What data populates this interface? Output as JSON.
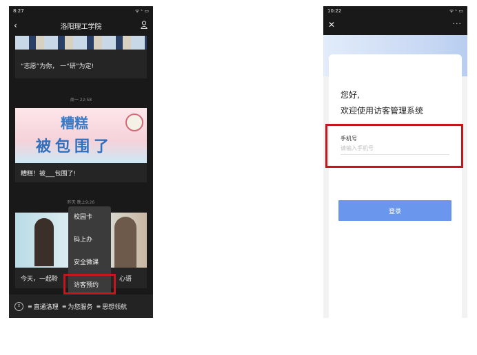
{
  "left_phone": {
    "status": {
      "time": "8:27",
      "right_icons": "ᯤ ᶫ ▭"
    },
    "header": {
      "title": "洛阳理工学院",
      "back_icon": "‹"
    },
    "feed": [
      {
        "caption": "“志愿”为你， 一“研”为定!",
        "timestamp": ""
      },
      {
        "caption": "糟糕！被___包围了!",
        "timestamp": "周一 22:58",
        "banner_title": "糟糕",
        "banner_sub": "被包围了"
      },
      {
        "caption": "今天，一起聆",
        "caption_tail": "心语",
        "timestamp": "昨天 晚上9:26"
      }
    ],
    "popup_menu": [
      "校园卡",
      "码上办",
      "安全微课",
      "访客预约"
    ],
    "tabbar": [
      "直通洛理",
      "为您服务",
      "思想领航"
    ]
  },
  "right_phone": {
    "status": {
      "time": "10:22",
      "right_icons": "ᯤ ᶫ ▭"
    },
    "header": {
      "close_icon": "✕",
      "more_icon": "···"
    },
    "greeting_line1": "您好,",
    "greeting_line2": "欢迎使用访客管理系统",
    "phone_label": "手机号",
    "phone_placeholder": "请输入手机号",
    "login_label": "登录"
  },
  "colors": {
    "highlight": "#c4161c",
    "login_button": "#6b96ee",
    "dark_bg": "#191919"
  }
}
